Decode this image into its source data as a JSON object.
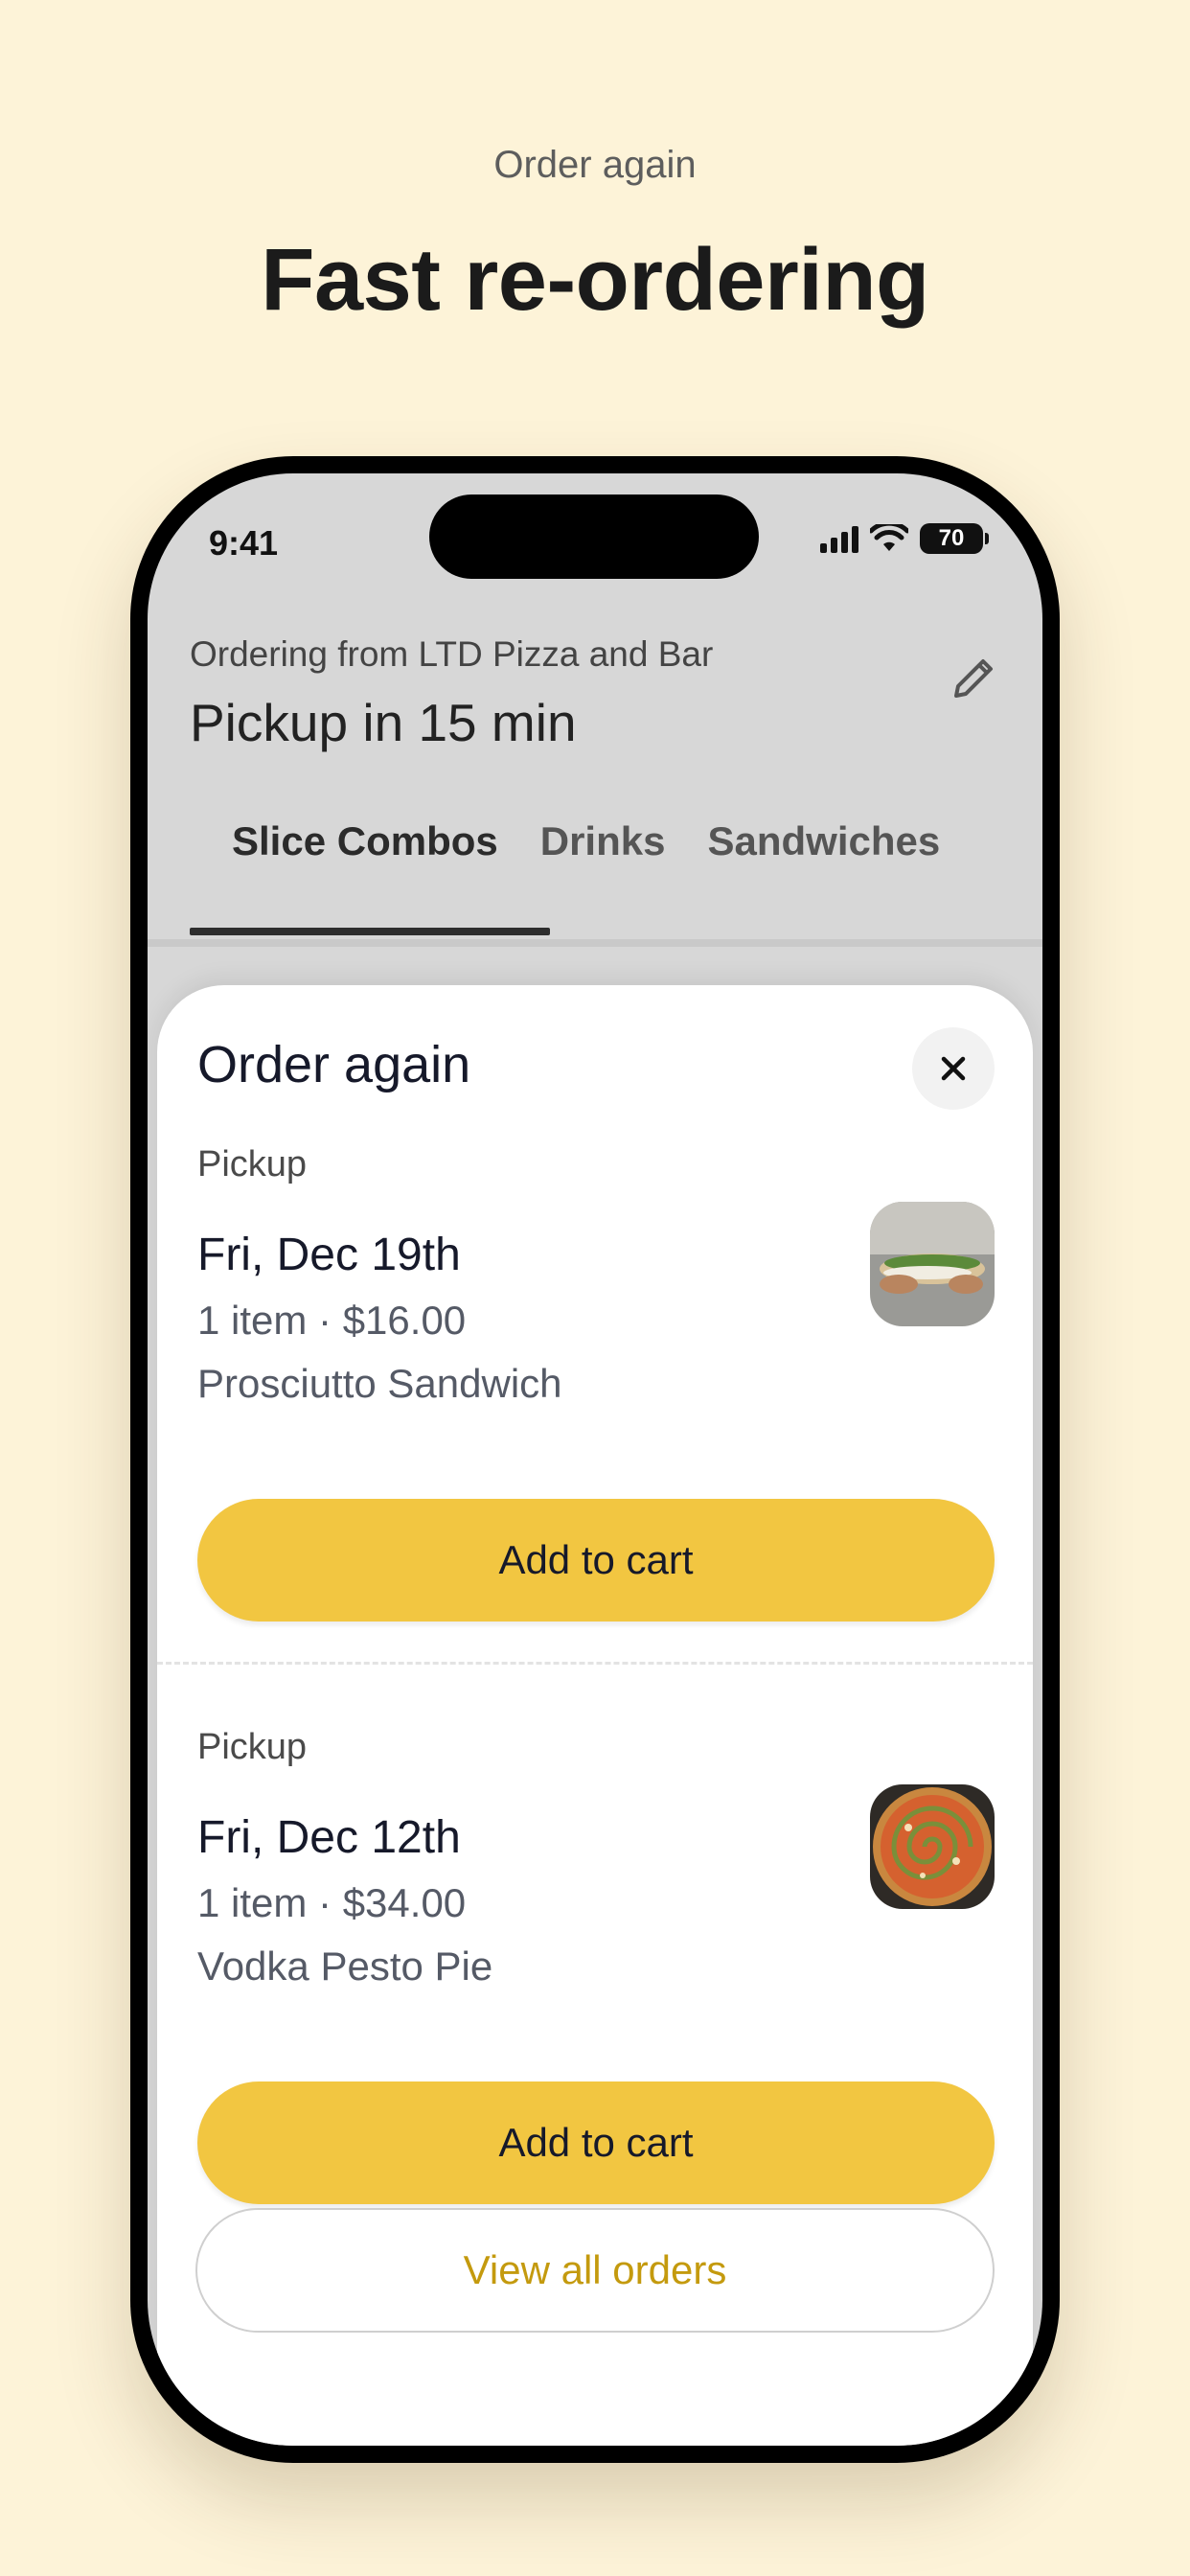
{
  "hero": {
    "eyebrow": "Order again",
    "title": "Fast re-ordering"
  },
  "status_bar": {
    "time": "9:41",
    "battery": "70"
  },
  "header": {
    "ordering_from": "Ordering from LTD Pizza and Bar",
    "pickup_time": "Pickup in 15 min",
    "edit_icon": "pencil-icon"
  },
  "tabs": [
    "Slice Combos",
    "Drinks",
    "Sandwiches"
  ],
  "active_tab": "Slice Combos",
  "sheet": {
    "title": "Order again",
    "close_icon": "close-icon",
    "orders": [
      {
        "label": "Pickup",
        "date": "Fri, Dec 19th",
        "meta": "1 item · $16.00",
        "item": "Prosciutto Sandwich",
        "button": "Add to cart"
      },
      {
        "label": "Pickup",
        "date": "Fri, Dec 12th",
        "meta": "1 item · $34.00",
        "item": "Vodka Pesto Pie",
        "button": "Add to cart"
      }
    ],
    "view_all": "View all orders"
  },
  "colors": {
    "background": "#FDF3D8",
    "accent": "#F2C641",
    "link": "#C49A0E"
  }
}
